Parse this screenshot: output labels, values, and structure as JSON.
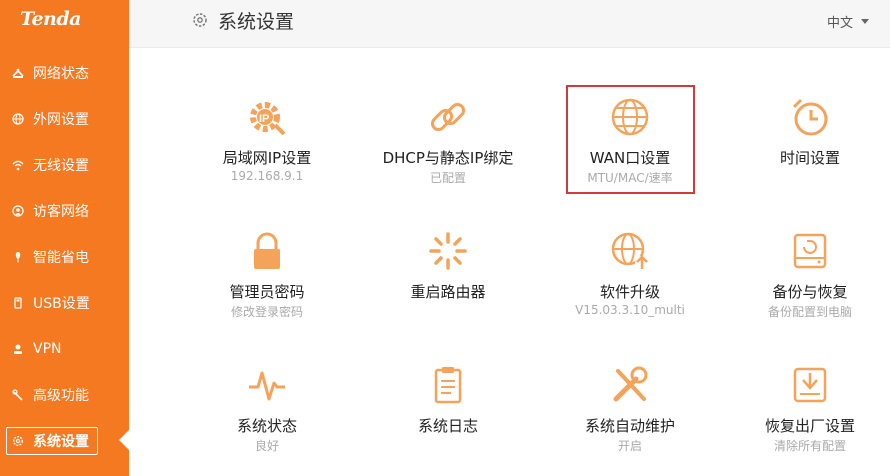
{
  "brand": {
    "logo_text": "Tenda",
    "accent_color": "#f47920",
    "highlight_color": "#d23b3b"
  },
  "sidebar": {
    "items": [
      {
        "label": "网络状态",
        "icon": "network-status-icon"
      },
      {
        "label": "外网设置",
        "icon": "globe-icon"
      },
      {
        "label": "无线设置",
        "icon": "wifi-icon"
      },
      {
        "label": "访客网络",
        "icon": "guest-icon"
      },
      {
        "label": "智能省电",
        "icon": "power-saving-icon"
      },
      {
        "label": "USB设置",
        "icon": "usb-icon"
      },
      {
        "label": "VPN",
        "icon": "vpn-icon"
      },
      {
        "label": "高级功能",
        "icon": "wrench-icon"
      },
      {
        "label": "系统设置",
        "icon": "gear-icon",
        "active": true
      }
    ]
  },
  "header": {
    "title": "系统设置",
    "language": "中文"
  },
  "tiles": [
    {
      "name": "局域网IP设置",
      "sub": "192.168.9.1",
      "icon": "lan-ip-gear-icon"
    },
    {
      "name": "DHCP与静态IP绑定",
      "sub": "已配置",
      "icon": "link-icon"
    },
    {
      "name": "WAN口设置",
      "sub": "MTU/MAC/速率",
      "icon": "globe-icon",
      "highlighted": true
    },
    {
      "name": "时间设置",
      "sub": "",
      "icon": "clock-icon"
    },
    {
      "name": "管理员密码",
      "sub": "修改登录密码",
      "icon": "lock-icon"
    },
    {
      "name": "重启路由器",
      "sub": "",
      "icon": "loading-spinner-icon"
    },
    {
      "name": "软件升级",
      "sub": "V15.03.3.10_multi",
      "icon": "globe-upgrade-icon"
    },
    {
      "name": "备份与恢复",
      "sub": "备份配置到电脑",
      "icon": "backup-drive-icon"
    },
    {
      "name": "系统状态",
      "sub": "良好",
      "icon": "pulse-icon"
    },
    {
      "name": "系统日志",
      "sub": "",
      "icon": "clipboard-icon"
    },
    {
      "name": "系统自动维护",
      "sub": "开启",
      "icon": "tools-icon"
    },
    {
      "name": "恢复出厂设置",
      "sub": "清除所有配置",
      "icon": "restore-box-icon"
    }
  ]
}
